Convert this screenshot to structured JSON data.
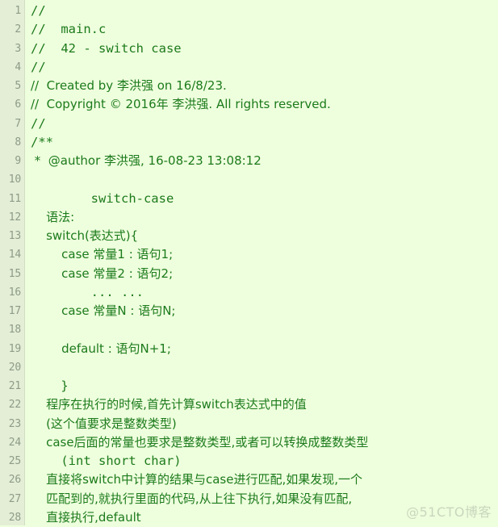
{
  "editor": {
    "language": "c",
    "background_color": "#eeffdd",
    "gutter_color": "#e4eed6",
    "text_color": "#1c7a1c",
    "line_number_color": "#8e9b88",
    "first_line_number": 1,
    "total_lines": 28,
    "line_numbers": [
      "1",
      "2",
      "3",
      "4",
      "5",
      "6",
      "7",
      "8",
      "9",
      "10",
      "11",
      "12",
      "13",
      "14",
      "15",
      "16",
      "17",
      "18",
      "19",
      "20",
      "21",
      "22",
      "23",
      "24",
      "25",
      "26",
      "27",
      "28"
    ],
    "lines": [
      {
        "n": "1",
        "text": "//",
        "cjk": false
      },
      {
        "n": "2",
        "text": "//  main.c",
        "cjk": false
      },
      {
        "n": "3",
        "text": "//  42 - switch case",
        "cjk": false
      },
      {
        "n": "4",
        "text": "//",
        "cjk": false
      },
      {
        "n": "5",
        "text": "//  Created by 李洪强 on 16/8/23.",
        "cjk": true
      },
      {
        "n": "6",
        "text": "//  Copyright © 2016年 李洪强. All rights reserved.",
        "cjk": true
      },
      {
        "n": "7",
        "text": "//",
        "cjk": false
      },
      {
        "n": "8",
        "text": "/**",
        "cjk": false
      },
      {
        "n": "9",
        "text": " *  @author 李洪强, 16-08-23 13:08:12",
        "cjk": true
      },
      {
        "n": "10",
        "text": "",
        "cjk": false
      },
      {
        "n": "11",
        "text": "        switch-case",
        "cjk": false
      },
      {
        "n": "12",
        "text": "    语法:",
        "cjk": true
      },
      {
        "n": "13",
        "text": "    switch(表达式){",
        "cjk": true
      },
      {
        "n": "14",
        "text": "        case 常量1 : 语句1;",
        "cjk": true
      },
      {
        "n": "15",
        "text": "        case 常量2 : 语句2;",
        "cjk": true
      },
      {
        "n": "16",
        "text": "        ... ...",
        "cjk": false
      },
      {
        "n": "17",
        "text": "        case 常量N : 语句N;",
        "cjk": true
      },
      {
        "n": "18",
        "text": "",
        "cjk": false
      },
      {
        "n": "19",
        "text": "        default : 语句N+1;",
        "cjk": true
      },
      {
        "n": "20",
        "text": "",
        "cjk": false
      },
      {
        "n": "21",
        "text": "    }",
        "cjk": false
      },
      {
        "n": "22",
        "text": "    程序在执行的时候,首先计算switch表达式中的值",
        "cjk": true
      },
      {
        "n": "23",
        "text": "    (这个值要求是整数类型)",
        "cjk": true
      },
      {
        "n": "24",
        "text": "    case后面的常量也要求是整数类型,或者可以转换成整数类型",
        "cjk": true
      },
      {
        "n": "25",
        "text": "    (int short char)",
        "cjk": false
      },
      {
        "n": "26",
        "text": "    直接将switch中计算的结果与case进行匹配,如果发现,一个",
        "cjk": true
      },
      {
        "n": "27",
        "text": "    匹配到的,就执行里面的代码,从上往下执行,如果没有匹配,",
        "cjk": true
      },
      {
        "n": "28",
        "text": "    直接执行,default",
        "cjk": true
      }
    ]
  },
  "watermark": {
    "text": "@51CTO博客",
    "color": "#c9d6bd"
  }
}
